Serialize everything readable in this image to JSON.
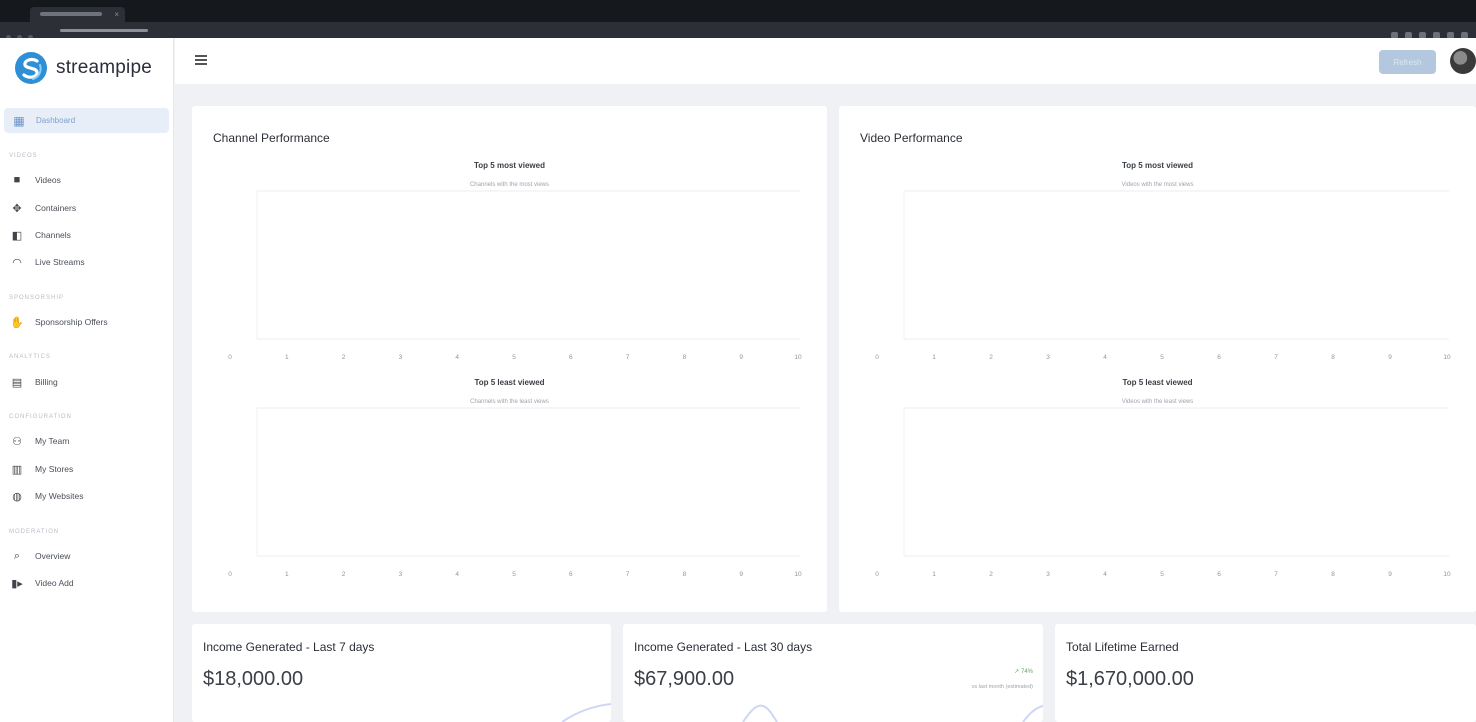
{
  "app": {
    "name": "streampipe"
  },
  "nav": {
    "active": {
      "label": "Dashboard",
      "icon": "grid-icon"
    },
    "sections": [
      {
        "label": "Videos",
        "items": [
          {
            "label": "Videos",
            "icon": "video-icon"
          },
          {
            "label": "Containers",
            "icon": "containers-icon"
          },
          {
            "label": "Channels",
            "icon": "channels-icon"
          },
          {
            "label": "Live Streams",
            "icon": "live-icon"
          }
        ]
      },
      {
        "label": "Sponsorship",
        "items": [
          {
            "label": "Sponsorship Offers",
            "icon": "handshake-icon"
          }
        ]
      },
      {
        "label": "Analytics",
        "items": [
          {
            "label": "Billing",
            "icon": "billing-icon"
          }
        ]
      },
      {
        "label": "Configuration",
        "items": [
          {
            "label": "My Team",
            "icon": "team-icon"
          },
          {
            "label": "My Stores",
            "icon": "store-icon"
          },
          {
            "label": "My Websites",
            "icon": "globe-icon"
          }
        ]
      },
      {
        "label": "Moderation",
        "items": [
          {
            "label": "Overview",
            "icon": "overview-icon"
          },
          {
            "label": "Video Add",
            "icon": "video-add-icon"
          }
        ]
      }
    ]
  },
  "header": {
    "button_label": "Refresh"
  },
  "panels": [
    {
      "title": "Channel Performance",
      "charts": [
        {
          "title": "Top 5 most viewed",
          "subtitle": "Channels with the most views",
          "ticks": [
            "0",
            "1",
            "2",
            "3",
            "4",
            "5",
            "6",
            "7",
            "8",
            "9",
            "10"
          ]
        },
        {
          "title": "Top 5 least viewed",
          "subtitle": "Channels with the least views",
          "ticks": [
            "0",
            "1",
            "2",
            "3",
            "4",
            "5",
            "6",
            "7",
            "8",
            "9",
            "10"
          ]
        }
      ]
    },
    {
      "title": "Video Performance",
      "charts": [
        {
          "title": "Top 5 most viewed",
          "subtitle": "Videos with the most views",
          "ticks": [
            "0",
            "1",
            "2",
            "3",
            "4",
            "5",
            "6",
            "7",
            "8",
            "9",
            "10"
          ]
        },
        {
          "title": "Top 5 least viewed",
          "subtitle": "Videos with the least views",
          "ticks": [
            "0",
            "1",
            "2",
            "3",
            "4",
            "5",
            "6",
            "7",
            "8",
            "9",
            "10"
          ]
        }
      ]
    }
  ],
  "stats": [
    {
      "title": "Income Generated - Last 7 days",
      "value": "$18,000.00"
    },
    {
      "title": "Income Generated - Last 30 days",
      "value": "$67,900.00",
      "change": "↗ 74%",
      "note": "vs last month (estimated)"
    },
    {
      "title": "Total Lifetime Earned",
      "value": "$1,670,000.00"
    }
  ],
  "chart_data": [
    {
      "type": "bar",
      "title": "Top 5 most viewed",
      "subtitle": "Channels with the most views",
      "xlim": [
        0,
        10
      ],
      "series": []
    },
    {
      "type": "bar",
      "title": "Top 5 least viewed",
      "subtitle": "Channels with the least views",
      "xlim": [
        0,
        10
      ],
      "series": []
    },
    {
      "type": "bar",
      "title": "Top 5 most viewed",
      "subtitle": "Videos with the most views",
      "xlim": [
        0,
        10
      ],
      "series": []
    },
    {
      "type": "bar",
      "title": "Top 5 least viewed",
      "subtitle": "Videos with the least views",
      "xlim": [
        0,
        10
      ],
      "series": []
    }
  ],
  "colors": {
    "accent": "#2f8fd6",
    "active_bg": "#e8eef8",
    "button": "#b3c8de"
  }
}
